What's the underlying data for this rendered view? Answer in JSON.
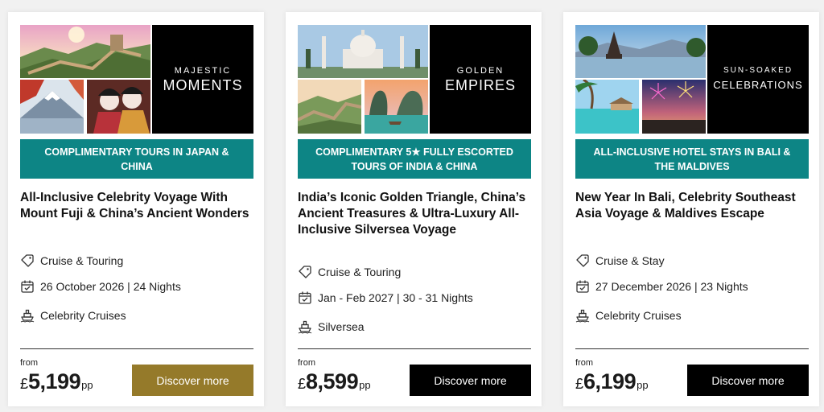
{
  "colors": {
    "banner_teal": "#0d8585",
    "gold_button": "#957a2a",
    "black_button": "#000000"
  },
  "cards": [
    {
      "title_block": {
        "top": "MAJESTIC",
        "bottom": "MOMENTS"
      },
      "images": [
        "great-wall-photo",
        "mount-fuji-photo",
        "geisha-photo"
      ],
      "banner": "COMPLIMENTARY TOURS IN JAPAN & CHINA",
      "headline": "All-Inclusive Celebrity Voyage With Mount Fuji & China’s Ancient Wonders",
      "type": "Cruise & Touring",
      "date": "26 October 2026 | 24 Nights",
      "line": "Celebrity Cruises",
      "from": "from",
      "currency": "£",
      "price": "5,199",
      "per": "pp",
      "button": "Discover more",
      "button_color": "#957a2a"
    },
    {
      "title_block": {
        "top": "GOLDEN",
        "bottom": "EMPIRES"
      },
      "images": [
        "taj-mahal-photo",
        "great-wall-photo",
        "ha-long-bay-photo"
      ],
      "banner": "COMPLIMENTARY 5★ FULLY ESCORTED TOURS OF INDIA & CHINA",
      "headline": "India’s Iconic Golden Triangle, China’s Ancient Treasures & Ultra-Luxury All-Inclusive Silversea Voyage",
      "type": "Cruise & Touring",
      "date": "Jan - Feb 2027 | 30 - 31 Nights",
      "line": "Silversea",
      "from": "from",
      "currency": "£",
      "price": "8,599",
      "per": "pp",
      "button": "Discover more",
      "button_color": "#000000"
    },
    {
      "title_block": {
        "top": "SUN-SOAKED",
        "bottom": "CELEBRATIONS"
      },
      "images": [
        "bali-temple-photo",
        "maldives-beach-photo",
        "fireworks-photo"
      ],
      "banner": "ALL-INCLUSIVE HOTEL STAYS IN BALI & THE MALDIVES",
      "headline": "New Year In Bali, Celebrity Southeast Asia Voyage & Maldives Escape",
      "type": "Cruise & Stay",
      "date": "27 December 2026 | 23 Nights",
      "line": "Celebrity Cruises",
      "from": "from",
      "currency": "£",
      "price": "6,199",
      "per": "pp",
      "button": "Discover more",
      "button_color": "#000000"
    }
  ]
}
